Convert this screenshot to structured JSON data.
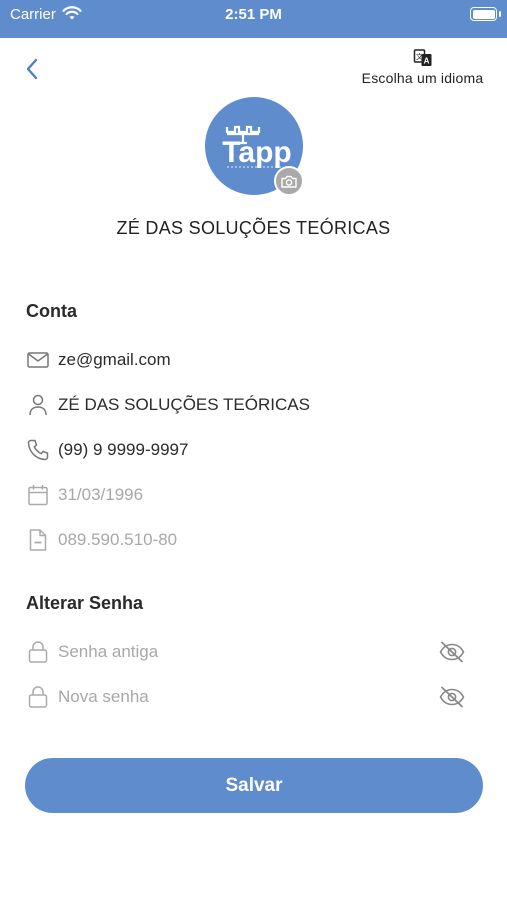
{
  "status_bar": {
    "carrier": "Carrier",
    "time": "2:51 PM"
  },
  "header": {
    "language_label": "Escolha um idioma"
  },
  "profile": {
    "name": "ZÉ DAS SOLUÇÕES TEÓRICAS",
    "logo_text": "Tapp"
  },
  "account": {
    "title": "Conta",
    "email": "ze@gmail.com",
    "name": "ZÉ DAS SOLUÇÕES TEÓRICAS",
    "phone": "(99) 9 9999-9997",
    "birthdate": "31/03/1996",
    "document": "089.590.510-80"
  },
  "password": {
    "title": "Alterar Senha",
    "old_placeholder": "Senha antiga",
    "new_placeholder": "Nova senha"
  },
  "actions": {
    "save_label": "Salvar"
  },
  "colors": {
    "primary": "#5f8ccc",
    "muted_text": "#a8a8a8",
    "camera_badge": "#a9a9a9"
  }
}
